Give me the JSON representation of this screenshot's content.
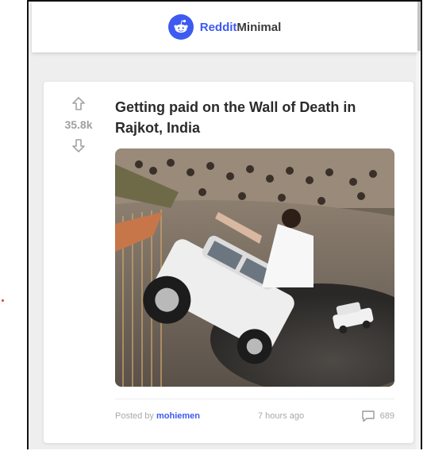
{
  "header": {
    "brand_part1": "Reddit",
    "brand_part2": "Minimal",
    "logo_icon": "reddit-alien-icon",
    "accent": "#3d5af1"
  },
  "post": {
    "score": "35.8k",
    "title": "Getting paid on the Wall of Death in Rajkot, India",
    "upvote_icon": "arrow-up-icon",
    "downvote_icon": "arrow-down-icon",
    "image_alt_icon": "post-image",
    "footer": {
      "posted_by": "Posted by",
      "author": "mohiemen",
      "time": "7 hours ago",
      "comments_icon": "comment-icon",
      "comments": "689"
    }
  }
}
